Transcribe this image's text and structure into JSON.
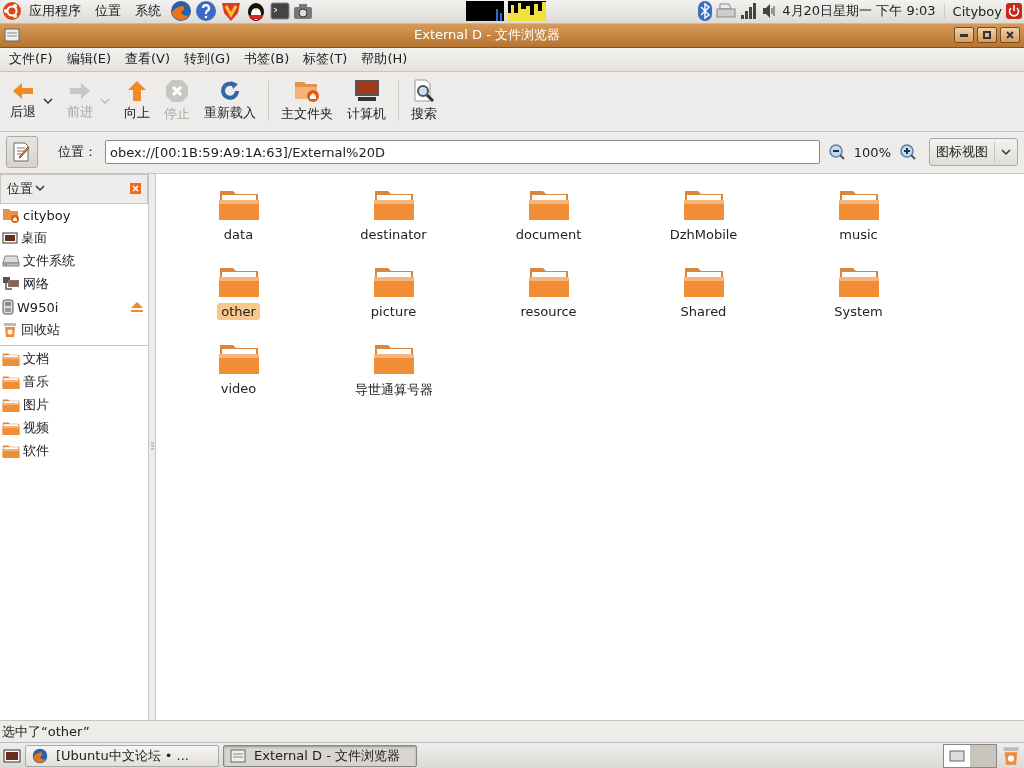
{
  "top_panel": {
    "menus": [
      "应用程序",
      "位置",
      "系统"
    ],
    "clock": "4月20日星期一 下午 9:03",
    "user": "Cityboy"
  },
  "window": {
    "title": "External D - 文件浏览器"
  },
  "menubar": [
    "文件(F)",
    "编辑(E)",
    "查看(V)",
    "转到(G)",
    "书签(B)",
    "标签(T)",
    "帮助(H)"
  ],
  "toolbar": [
    {
      "kind": "back",
      "label": "后退",
      "disabled": false,
      "dropdown": true
    },
    {
      "kind": "forward",
      "label": "前进",
      "disabled": true,
      "dropdown": true
    },
    {
      "kind": "up",
      "label": "向上",
      "disabled": false,
      "dropdown": false
    },
    {
      "kind": "stop",
      "label": "停止",
      "disabled": true,
      "dropdown": false
    },
    {
      "kind": "reload",
      "label": "重新载入",
      "disabled": false,
      "dropdown": false
    },
    {
      "kind": "separator"
    },
    {
      "kind": "home",
      "label": "主文件夹",
      "disabled": false,
      "dropdown": false
    },
    {
      "kind": "computer",
      "label": "计算机",
      "disabled": false,
      "dropdown": false
    },
    {
      "kind": "separator"
    },
    {
      "kind": "search",
      "label": "搜索",
      "disabled": false,
      "dropdown": false
    }
  ],
  "location": {
    "label": "位置：",
    "value": "obex://[00:1B:59:A9:1A:63]/External%20D",
    "zoom": "100%",
    "view": "图标视图"
  },
  "sidebar": {
    "header": "位置",
    "items": [
      {
        "kind": "home",
        "label": "cityboy",
        "ejectable": false
      },
      {
        "kind": "desktop",
        "label": "桌面",
        "ejectable": false
      },
      {
        "kind": "drive",
        "label": "文件系统",
        "ejectable": false
      },
      {
        "kind": "network",
        "label": "网络",
        "ejectable": false
      },
      {
        "kind": "phone",
        "label": "W950i",
        "ejectable": true
      },
      {
        "kind": "trash",
        "label": "回收站",
        "ejectable": false
      },
      {
        "kind": "separator"
      },
      {
        "kind": "folder",
        "label": "文档",
        "ejectable": false
      },
      {
        "kind": "folder",
        "label": "音乐",
        "ejectable": false
      },
      {
        "kind": "folder",
        "label": "图片",
        "ejectable": false
      },
      {
        "kind": "folder",
        "label": "视频",
        "ejectable": false
      },
      {
        "kind": "folder",
        "label": "软件",
        "ejectable": false
      }
    ]
  },
  "files": [
    {
      "name": "data",
      "selected": false
    },
    {
      "name": "destinator",
      "selected": false
    },
    {
      "name": "document",
      "selected": false
    },
    {
      "name": "DzhMobile",
      "selected": false
    },
    {
      "name": "music",
      "selected": false
    },
    {
      "name": "other",
      "selected": true
    },
    {
      "name": "picture",
      "selected": false
    },
    {
      "name": "resource",
      "selected": false
    },
    {
      "name": "Shared",
      "selected": false
    },
    {
      "name": "System",
      "selected": false
    },
    {
      "name": "video",
      "selected": false
    },
    {
      "name": "导世通算号器",
      "selected": false
    }
  ],
  "status_bar": "选中了“other”",
  "taskbar": [
    {
      "kind": "browser",
      "label": "[Ubuntu中文论坛 • ...",
      "selected": false
    },
    {
      "kind": "files",
      "label": "External D - 文件浏览器",
      "selected": true
    }
  ]
}
